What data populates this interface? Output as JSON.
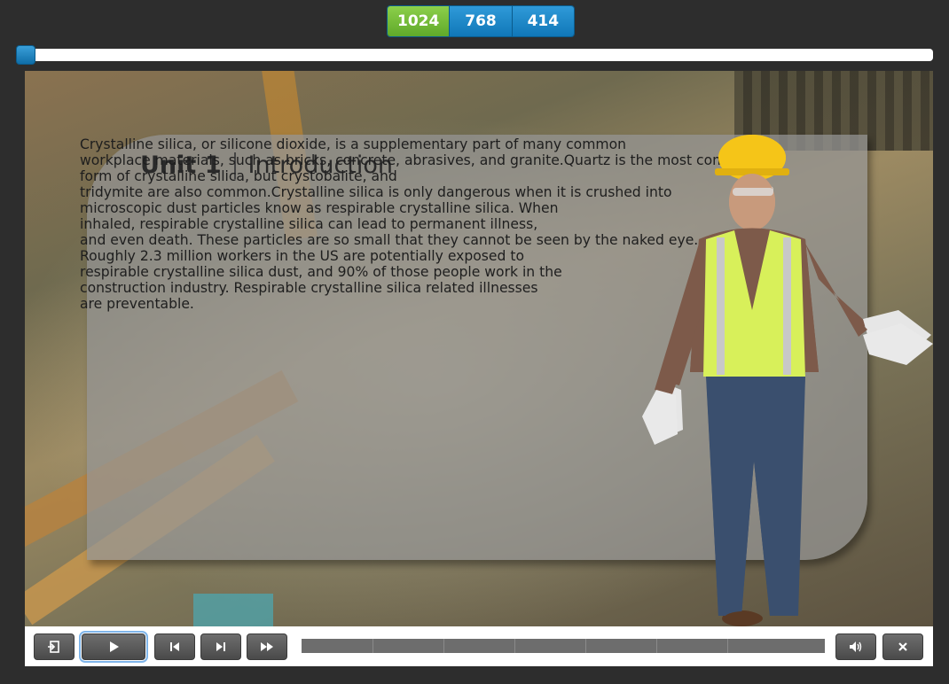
{
  "resolution_switcher": {
    "options": [
      "1024",
      "768",
      "414"
    ],
    "selected": "1024"
  },
  "top_progress": {
    "value": 0.0
  },
  "slide": {
    "title_unit": "Unit 1",
    "title_topic": "Introduction",
    "body_lines": [
      "Crystalline silica, or silicone dioxide, is a supplementary part of many common",
      "workplace materials, such as bricks, concrete, abrasives, and granite.Quartz is the most common",
      "form of crystalline silica, but crystobalite, and",
      "tridymite are also common.Crystalline silica is only dangerous when it is crushed into",
      "microscopic dust particles know as respirable crystalline silica. When",
      "inhaled, respirable crystalline silica can lead to permanent illness,",
      "and even death. These particles are so small that they cannot be seen by the naked eye.",
      "Roughly 2.3 million workers in the US are potentially exposed to",
      "respirable crystalline silica dust, and 90% of those people work in the",
      "construction industry. Respirable crystalline silica related illnesses",
      "are preventable."
    ]
  },
  "controls": {
    "exit_icon": "exit-icon",
    "play_icon": "play-icon",
    "prev_icon": "skip-back-icon",
    "next_icon": "skip-forward-icon",
    "ff_icon": "fast-forward-icon",
    "volume_icon": "volume-icon",
    "close_icon": "close-icon",
    "timeline_progress": 0.0
  },
  "colors": {
    "active_option": "#6cb832",
    "option": "#1a86c8",
    "background": "#2d2d2d"
  }
}
